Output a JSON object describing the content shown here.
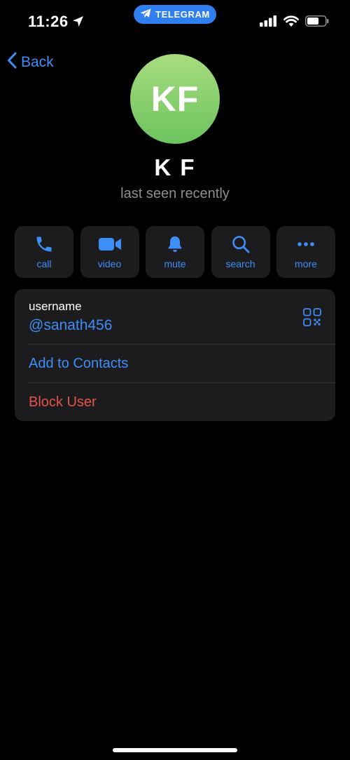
{
  "status_bar": {
    "time": "11:26",
    "location_icon": "location-arrow-icon",
    "app_pill": "TELEGRAM",
    "icons": [
      "cellular-signal-icon",
      "wifi-icon",
      "battery-icon"
    ]
  },
  "nav": {
    "back_label": "Back"
  },
  "profile": {
    "initials": "KF",
    "name": "K F",
    "status": "last seen recently",
    "avatar_color": "#7fcb6a"
  },
  "actions": [
    {
      "label": "call",
      "icon": "phone-icon"
    },
    {
      "label": "video",
      "icon": "video-camera-icon"
    },
    {
      "label": "mute",
      "icon": "bell-icon"
    },
    {
      "label": "search",
      "icon": "search-icon"
    },
    {
      "label": "more",
      "icon": "more-dots-icon"
    }
  ],
  "info": {
    "username_label": "username",
    "username_value": "@sanath456",
    "qr_icon": "qr-code-icon",
    "add_contacts": "Add to Contacts",
    "block_user": "Block User"
  },
  "colors": {
    "accent": "#3e8ef7",
    "destructive": "#e5534b",
    "background": "#000000",
    "card": "#1c1c1e",
    "pill": "#2f7ff0"
  }
}
